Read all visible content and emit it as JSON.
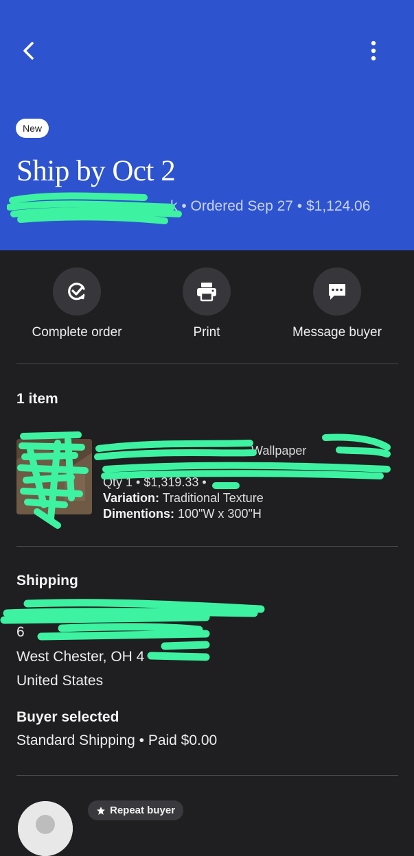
{
  "header": {
    "badge": "New",
    "title": "Ship by Oct 2",
    "buyer_name_visible": "k",
    "meta": " • Ordered Sep 27 • $1,124.06",
    "bg_color": "#2d53cf"
  },
  "icons": {
    "back": "chevron-left-icon",
    "more": "more-vertical-icon"
  },
  "actions": [
    {
      "label": "Complete order",
      "icon": "complete-order-icon"
    },
    {
      "label": "Print",
      "icon": "printer-icon"
    },
    {
      "label": "Message buyer",
      "icon": "message-icon"
    }
  ],
  "items_section": {
    "title": "1 item",
    "item": {
      "title_visible": "Wallpaper",
      "qty_price": "Qty 1 • $1,319.33 •",
      "variation_label": "Variation:",
      "variation_value": " Traditional Texture",
      "dimentions_label": "Dimentions:",
      "dimentions_value": " 100\"W x 300\"H"
    }
  },
  "shipping": {
    "title": "Shipping",
    "address_line_partial": "6",
    "city_line": "West Chester, OH 4",
    "country": "United States",
    "buyer_selected_title": "Buyer selected",
    "method": "Standard Shipping • Paid $0.00"
  },
  "buyer": {
    "repeat_badge": "Repeat buyer"
  }
}
